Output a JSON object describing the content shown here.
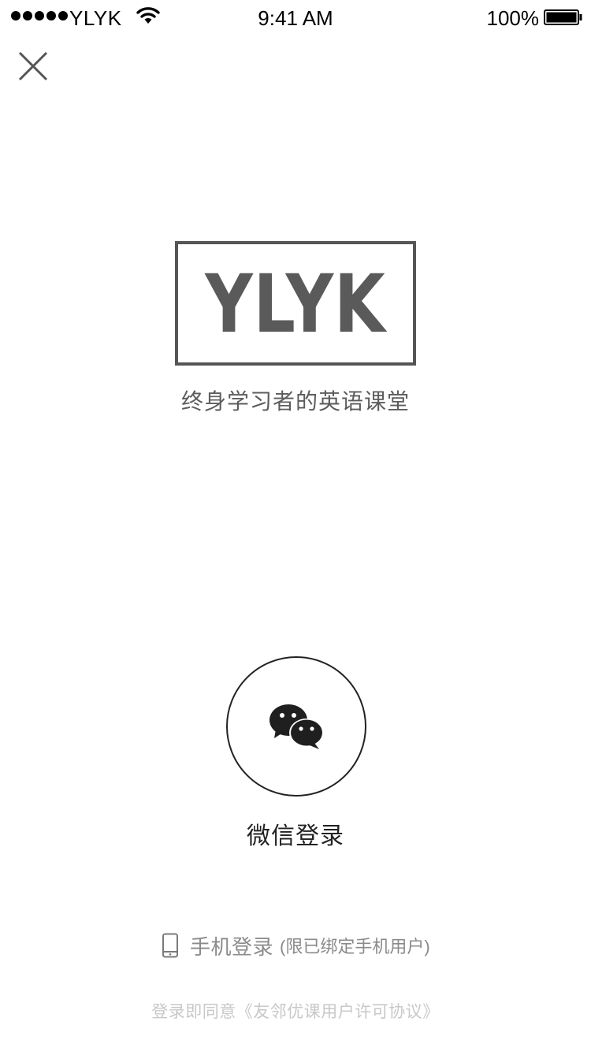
{
  "status_bar": {
    "carrier": "YLYK",
    "time": "9:41 AM",
    "battery": "100%"
  },
  "header": {
    "close_icon": "close-icon"
  },
  "logo": {
    "text": "YLYK",
    "tagline": "终身学习者的英语课堂"
  },
  "wechat_login": {
    "icon": "wechat-icon",
    "label": "微信登录"
  },
  "phone_login": {
    "icon": "mobile-phone-icon",
    "label": "手机登录",
    "note": "(限已绑定手机用户)"
  },
  "agreement": {
    "prefix": "登录即同意",
    "link": "《友邻优课用户许可协议》"
  },
  "colors": {
    "logo_gray": "#555555",
    "text_dark": "#222222",
    "text_muted": "#8a8a8a",
    "text_faint": "#c8c8c8"
  }
}
